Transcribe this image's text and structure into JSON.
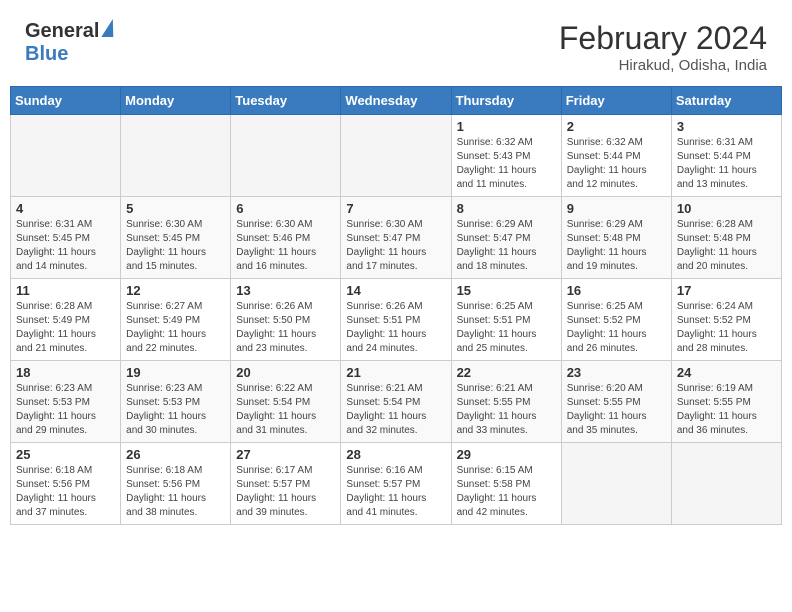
{
  "header": {
    "logo_general": "General",
    "logo_blue": "Blue",
    "month_year": "February 2024",
    "location": "Hirakud, Odisha, India"
  },
  "weekdays": [
    "Sunday",
    "Monday",
    "Tuesday",
    "Wednesday",
    "Thursday",
    "Friday",
    "Saturday"
  ],
  "weeks": [
    [
      {
        "day": "",
        "sunrise": "",
        "sunset": "",
        "daylight": "",
        "empty": true
      },
      {
        "day": "",
        "sunrise": "",
        "sunset": "",
        "daylight": "",
        "empty": true
      },
      {
        "day": "",
        "sunrise": "",
        "sunset": "",
        "daylight": "",
        "empty": true
      },
      {
        "day": "",
        "sunrise": "",
        "sunset": "",
        "daylight": "",
        "empty": true
      },
      {
        "day": "1",
        "sunrise": "Sunrise: 6:32 AM",
        "sunset": "Sunset: 5:43 PM",
        "daylight": "Daylight: 11 hours and 11 minutes."
      },
      {
        "day": "2",
        "sunrise": "Sunrise: 6:32 AM",
        "sunset": "Sunset: 5:44 PM",
        "daylight": "Daylight: 11 hours and 12 minutes."
      },
      {
        "day": "3",
        "sunrise": "Sunrise: 6:31 AM",
        "sunset": "Sunset: 5:44 PM",
        "daylight": "Daylight: 11 hours and 13 minutes."
      }
    ],
    [
      {
        "day": "4",
        "sunrise": "Sunrise: 6:31 AM",
        "sunset": "Sunset: 5:45 PM",
        "daylight": "Daylight: 11 hours and 14 minutes."
      },
      {
        "day": "5",
        "sunrise": "Sunrise: 6:30 AM",
        "sunset": "Sunset: 5:45 PM",
        "daylight": "Daylight: 11 hours and 15 minutes."
      },
      {
        "day": "6",
        "sunrise": "Sunrise: 6:30 AM",
        "sunset": "Sunset: 5:46 PM",
        "daylight": "Daylight: 11 hours and 16 minutes."
      },
      {
        "day": "7",
        "sunrise": "Sunrise: 6:30 AM",
        "sunset": "Sunset: 5:47 PM",
        "daylight": "Daylight: 11 hours and 17 minutes."
      },
      {
        "day": "8",
        "sunrise": "Sunrise: 6:29 AM",
        "sunset": "Sunset: 5:47 PM",
        "daylight": "Daylight: 11 hours and 18 minutes."
      },
      {
        "day": "9",
        "sunrise": "Sunrise: 6:29 AM",
        "sunset": "Sunset: 5:48 PM",
        "daylight": "Daylight: 11 hours and 19 minutes."
      },
      {
        "day": "10",
        "sunrise": "Sunrise: 6:28 AM",
        "sunset": "Sunset: 5:48 PM",
        "daylight": "Daylight: 11 hours and 20 minutes."
      }
    ],
    [
      {
        "day": "11",
        "sunrise": "Sunrise: 6:28 AM",
        "sunset": "Sunset: 5:49 PM",
        "daylight": "Daylight: 11 hours and 21 minutes."
      },
      {
        "day": "12",
        "sunrise": "Sunrise: 6:27 AM",
        "sunset": "Sunset: 5:49 PM",
        "daylight": "Daylight: 11 hours and 22 minutes."
      },
      {
        "day": "13",
        "sunrise": "Sunrise: 6:26 AM",
        "sunset": "Sunset: 5:50 PM",
        "daylight": "Daylight: 11 hours and 23 minutes."
      },
      {
        "day": "14",
        "sunrise": "Sunrise: 6:26 AM",
        "sunset": "Sunset: 5:51 PM",
        "daylight": "Daylight: 11 hours and 24 minutes."
      },
      {
        "day": "15",
        "sunrise": "Sunrise: 6:25 AM",
        "sunset": "Sunset: 5:51 PM",
        "daylight": "Daylight: 11 hours and 25 minutes."
      },
      {
        "day": "16",
        "sunrise": "Sunrise: 6:25 AM",
        "sunset": "Sunset: 5:52 PM",
        "daylight": "Daylight: 11 hours and 26 minutes."
      },
      {
        "day": "17",
        "sunrise": "Sunrise: 6:24 AM",
        "sunset": "Sunset: 5:52 PM",
        "daylight": "Daylight: 11 hours and 28 minutes."
      }
    ],
    [
      {
        "day": "18",
        "sunrise": "Sunrise: 6:23 AM",
        "sunset": "Sunset: 5:53 PM",
        "daylight": "Daylight: 11 hours and 29 minutes."
      },
      {
        "day": "19",
        "sunrise": "Sunrise: 6:23 AM",
        "sunset": "Sunset: 5:53 PM",
        "daylight": "Daylight: 11 hours and 30 minutes."
      },
      {
        "day": "20",
        "sunrise": "Sunrise: 6:22 AM",
        "sunset": "Sunset: 5:54 PM",
        "daylight": "Daylight: 11 hours and 31 minutes."
      },
      {
        "day": "21",
        "sunrise": "Sunrise: 6:21 AM",
        "sunset": "Sunset: 5:54 PM",
        "daylight": "Daylight: 11 hours and 32 minutes."
      },
      {
        "day": "22",
        "sunrise": "Sunrise: 6:21 AM",
        "sunset": "Sunset: 5:55 PM",
        "daylight": "Daylight: 11 hours and 33 minutes."
      },
      {
        "day": "23",
        "sunrise": "Sunrise: 6:20 AM",
        "sunset": "Sunset: 5:55 PM",
        "daylight": "Daylight: 11 hours and 35 minutes."
      },
      {
        "day": "24",
        "sunrise": "Sunrise: 6:19 AM",
        "sunset": "Sunset: 5:55 PM",
        "daylight": "Daylight: 11 hours and 36 minutes."
      }
    ],
    [
      {
        "day": "25",
        "sunrise": "Sunrise: 6:18 AM",
        "sunset": "Sunset: 5:56 PM",
        "daylight": "Daylight: 11 hours and 37 minutes."
      },
      {
        "day": "26",
        "sunrise": "Sunrise: 6:18 AM",
        "sunset": "Sunset: 5:56 PM",
        "daylight": "Daylight: 11 hours and 38 minutes."
      },
      {
        "day": "27",
        "sunrise": "Sunrise: 6:17 AM",
        "sunset": "Sunset: 5:57 PM",
        "daylight": "Daylight: 11 hours and 39 minutes."
      },
      {
        "day": "28",
        "sunrise": "Sunrise: 6:16 AM",
        "sunset": "Sunset: 5:57 PM",
        "daylight": "Daylight: 11 hours and 41 minutes."
      },
      {
        "day": "29",
        "sunrise": "Sunrise: 6:15 AM",
        "sunset": "Sunset: 5:58 PM",
        "daylight": "Daylight: 11 hours and 42 minutes."
      },
      {
        "day": "",
        "sunrise": "",
        "sunset": "",
        "daylight": "",
        "empty": true
      },
      {
        "day": "",
        "sunrise": "",
        "sunset": "",
        "daylight": "",
        "empty": true
      }
    ]
  ]
}
